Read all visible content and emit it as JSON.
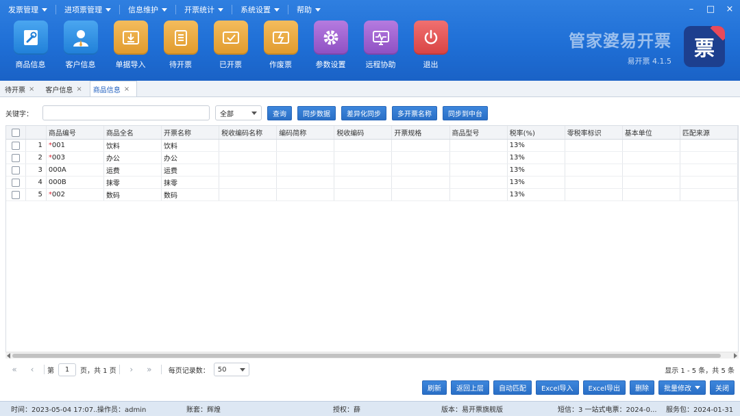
{
  "menu": [
    "发票管理",
    "进项票管理",
    "信息维护",
    "开票统计",
    "系统设置",
    "帮助"
  ],
  "window_controls": [
    "–",
    "□",
    "×"
  ],
  "toolbar": [
    {
      "label": "商品信息",
      "icon": "wrench-icon",
      "color": "#2a8fe6"
    },
    {
      "label": "客户信息",
      "icon": "user-icon",
      "color": "#2a8fe6"
    },
    {
      "label": "单据导入",
      "icon": "import-icon",
      "color": "#e6a23c"
    },
    {
      "label": "待开票",
      "icon": "clipboard-icon",
      "color": "#e6a23c"
    },
    {
      "label": "已开票",
      "icon": "ticket-check-icon",
      "color": "#e6a23c"
    },
    {
      "label": "作废票",
      "icon": "ticket-void-icon",
      "color": "#e6a23c"
    },
    {
      "label": "参数设置",
      "icon": "gear-icon",
      "color": "#9b59c6"
    },
    {
      "label": "远程协助",
      "icon": "monitor-icon",
      "color": "#9b59c6"
    },
    {
      "label": "退出",
      "icon": "power-icon",
      "color": "#e05555"
    }
  ],
  "brand": {
    "title": "管家婆易开票",
    "version": "易开票 4.1.5",
    "logo_char": "票"
  },
  "tabs": [
    {
      "label": "待开票",
      "active": false
    },
    {
      "label": "客户信息",
      "active": false
    },
    {
      "label": "商品信息",
      "active": true
    }
  ],
  "search": {
    "label": "关键字：",
    "placeholder": "",
    "scope": "全部"
  },
  "search_buttons": [
    "查询",
    "同步数据",
    "差异化同步",
    "多开票名称",
    "同步到中台"
  ],
  "table": {
    "columns": [
      "商品编号",
      "商品全名",
      "开票名称",
      "税收编码名称",
      "编码简称",
      "税收编码",
      "开票规格",
      "商品型号",
      "税率(%)",
      "零税率标识",
      "基本单位",
      "匹配来源"
    ],
    "rows": [
      {
        "no": "1",
        "code": "001",
        "star": "*",
        "name": "饮料",
        "inv_name": "饮料",
        "rate": "13%"
      },
      {
        "no": "2",
        "code": "003",
        "star": "*",
        "name": "办公",
        "inv_name": "办公",
        "rate": "13%"
      },
      {
        "no": "3",
        "code": "000A",
        "star": "",
        "name": "运费",
        "inv_name": "运费",
        "rate": "13%"
      },
      {
        "no": "4",
        "code": "000B",
        "star": "",
        "name": "抹零",
        "inv_name": "抹零",
        "rate": "13%"
      },
      {
        "no": "5",
        "code": "002",
        "star": "*",
        "name": "数码",
        "inv_name": "数码",
        "rate": "13%"
      }
    ]
  },
  "pager": {
    "page_prefix": "第",
    "page": "1",
    "page_suffix": "页，共 1 页",
    "size_label": "每页记录数：",
    "size": "50",
    "info": "显示 1 - 5 条，共 5 条"
  },
  "actions": [
    "刷新",
    "返回上层",
    "自动匹配",
    "Excel导入",
    "Excel导出",
    "删除",
    "批量修改",
    "关闭"
  ],
  "status": {
    "time": "时间：2023-05-04 17:07...",
    "operator": "操作员：admin",
    "account": "账套：辉煌",
    "license": "授权：薛",
    "edition": "版本：易开票旗舰版",
    "sms": "短信：3 一站式电票：2024-0...",
    "service": "服务包：2024-01-31"
  }
}
